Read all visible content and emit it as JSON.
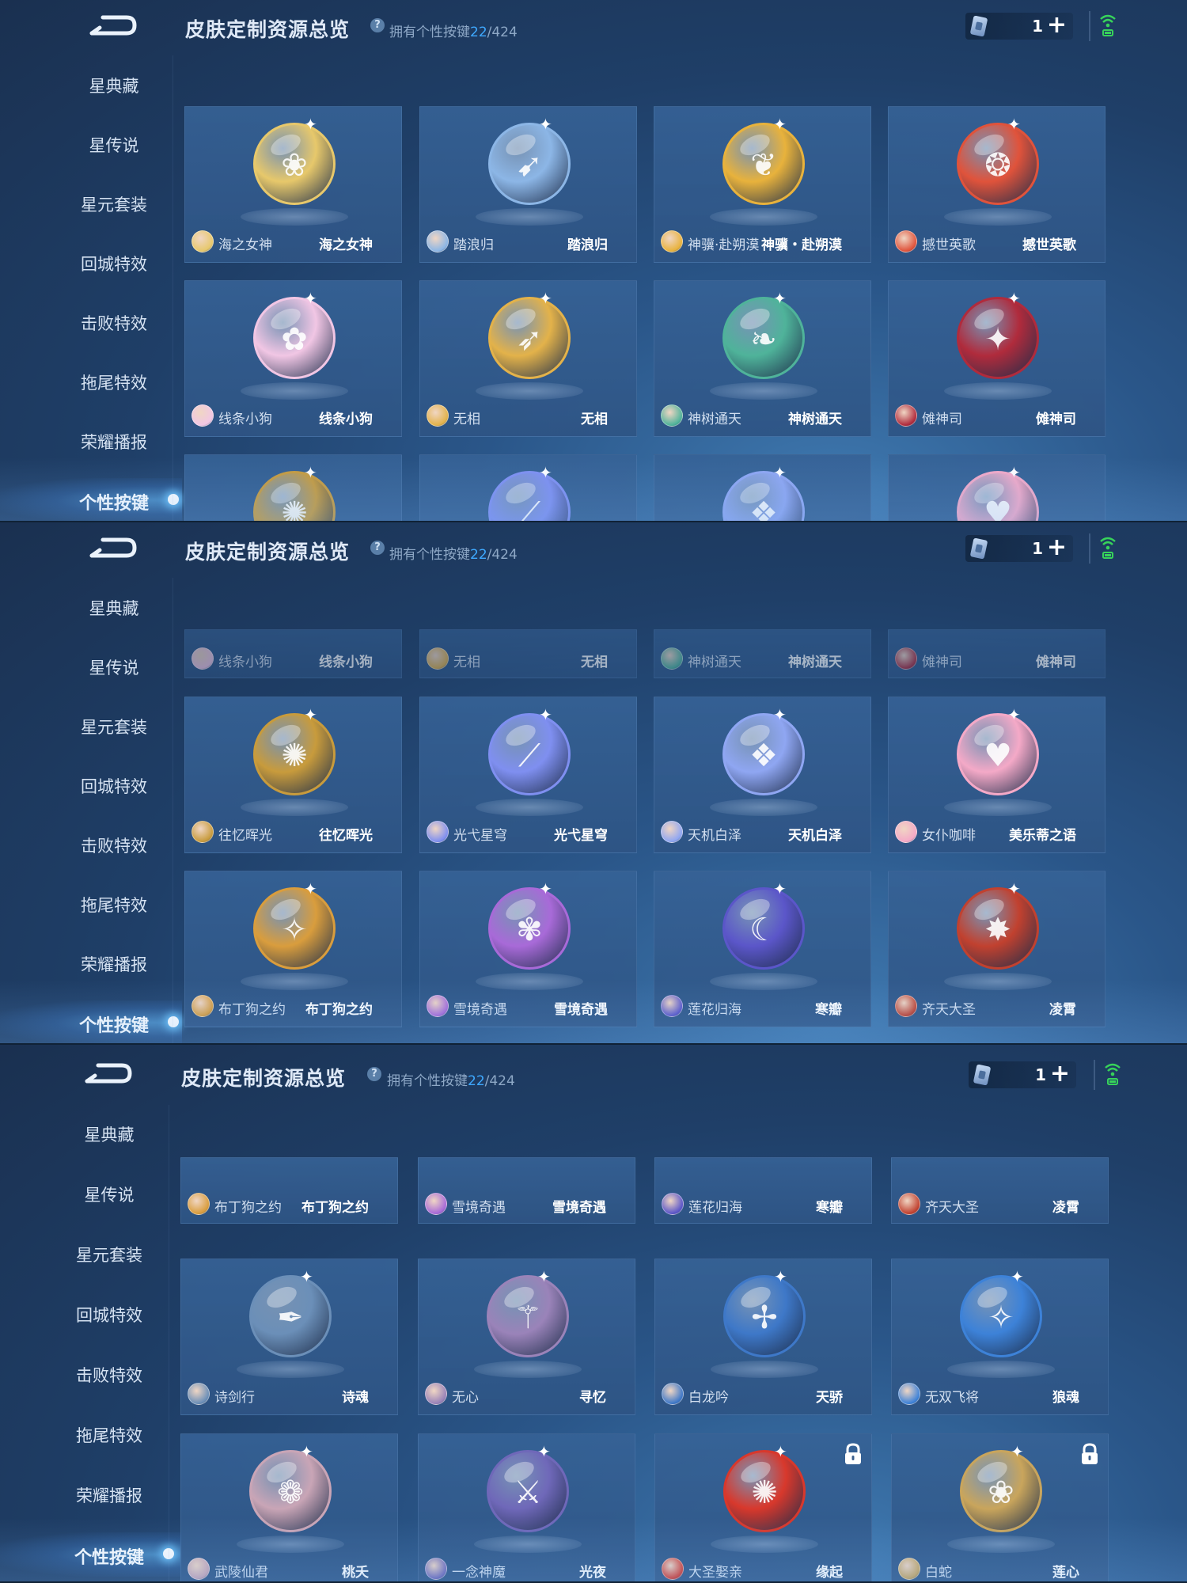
{
  "header": {
    "title": "皮肤定制资源总览",
    "help_glyph": "?",
    "owned_prefix": "拥有个性按键",
    "owned_current": "22",
    "owned_total": "/424",
    "currency_value": "1",
    "add_glyph": "+"
  },
  "sidebar": {
    "items": [
      {
        "label": "星典藏"
      },
      {
        "label": "星传说"
      },
      {
        "label": "星元套装"
      },
      {
        "label": "回城特效"
      },
      {
        "label": "击败特效"
      },
      {
        "label": "拖尾特效"
      },
      {
        "label": "荣耀播报"
      },
      {
        "label": "个性按键"
      }
    ],
    "active_index": 7
  },
  "cards": {
    "c1": {
      "hero": "海之女神",
      "skin": "海之女神",
      "color": "#e7c86b",
      "glyph": "❀"
    },
    "c2": {
      "hero": "踏浪归",
      "skin": "踏浪归",
      "color": "#8cb6e6",
      "glyph": "➹"
    },
    "c3": {
      "hero": "神骥·赴朔漠",
      "skin": "神骥・赴朔漠",
      "color": "#e8b23c",
      "glyph": "❦"
    },
    "c4": {
      "hero": "撼世英歌",
      "skin": "撼世英歌",
      "color": "#e0533b",
      "glyph": "❂"
    },
    "c5": {
      "hero": "线条小狗",
      "skin": "线条小狗",
      "color": "#f1c6e4",
      "glyph": "✿"
    },
    "c6": {
      "hero": "无相",
      "skin": "无相",
      "color": "#e3b24a",
      "glyph": "➶"
    },
    "c7": {
      "hero": "神树通天",
      "skin": "神树通天",
      "color": "#4fb39a",
      "glyph": "❧"
    },
    "c8": {
      "hero": "傩神司",
      "skin": "傩神司",
      "color": "#b02b3c",
      "glyph": "✦"
    },
    "c9": {
      "hero": "往忆晖光",
      "skin": "往忆晖光",
      "color": "#c89b3c",
      "glyph": "✺"
    },
    "c10": {
      "hero": "光弋星穹",
      "skin": "光弋星穹",
      "color": "#7f8ff0",
      "glyph": "⟋"
    },
    "c11": {
      "hero": "天机白泽",
      "skin": "天机白泽",
      "color": "#8fa6f2",
      "glyph": "❖"
    },
    "c12": {
      "hero": "女仆咖啡",
      "skin": "美乐蒂之语",
      "color": "#f4a9c7",
      "glyph": "♥"
    },
    "c13": {
      "hero": "布丁狗之约",
      "skin": "布丁狗之约",
      "color": "#d99d3d",
      "glyph": "✧"
    },
    "c14": {
      "hero": "雪境奇遇",
      "skin": "雪境奇遇",
      "color": "#a86ad8",
      "glyph": "✾"
    },
    "c15": {
      "hero": "莲花归海",
      "skin": "寒瓣",
      "color": "#5b56c9",
      "glyph": "☾"
    },
    "c16": {
      "hero": "齐天大圣",
      "skin": "凌霄",
      "color": "#c1412f",
      "glyph": "✸"
    },
    "c17": {
      "hero": "诗剑行",
      "skin": "诗魂",
      "color": "#6b8fb8",
      "glyph": "✒"
    },
    "c18": {
      "hero": "无心",
      "skin": "寻忆",
      "color": "#9a83b9",
      "glyph": "⚚"
    },
    "c19": {
      "hero": "白龙吟",
      "skin": "天骄",
      "color": "#3e78c8",
      "glyph": "✢"
    },
    "c20": {
      "hero": "无双飞将",
      "skin": "狼魂",
      "color": "#3d82d8",
      "glyph": "✧"
    },
    "c21": {
      "hero": "武陵仙君",
      "skin": "桃夭",
      "color": "#c9a5b6",
      "glyph": "❁"
    },
    "c22": {
      "hero": "一念神魔",
      "skin": "光夜",
      "color": "#6f68b9",
      "glyph": "⚔"
    },
    "c23": {
      "hero": "大圣娶亲",
      "skin": "缘起",
      "color": "#d8382c",
      "glyph": "✺"
    },
    "c24": {
      "hero": "白蛇",
      "skin": "莲心",
      "color": "#c9a55c",
      "glyph": "❀"
    }
  }
}
